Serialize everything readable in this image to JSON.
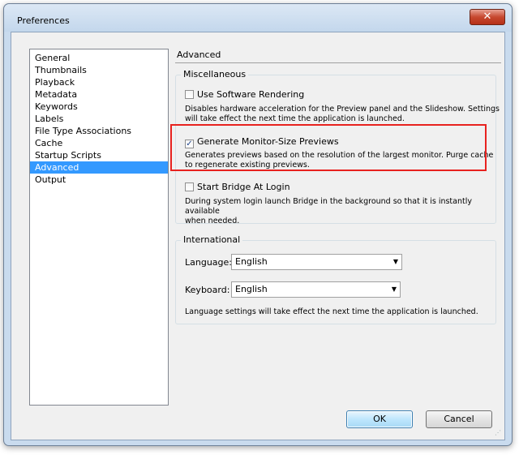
{
  "window": {
    "title": "Preferences",
    "close_glyph": "✕"
  },
  "categories": [
    {
      "label": "General"
    },
    {
      "label": "Thumbnails"
    },
    {
      "label": "Playback"
    },
    {
      "label": "Metadata"
    },
    {
      "label": "Keywords"
    },
    {
      "label": "Labels"
    },
    {
      "label": "File Type Associations"
    },
    {
      "label": "Cache"
    },
    {
      "label": "Startup Scripts"
    },
    {
      "label": "Advanced",
      "selected": true
    },
    {
      "label": "Output"
    }
  ],
  "panel": {
    "title": "Advanced",
    "misc": {
      "label": "Miscellaneous",
      "options": [
        {
          "label": "Use Software Rendering",
          "checked": false,
          "description_lines": [
            "Disables hardware acceleration for the Preview panel and the Slideshow. Settings",
            "will take effect the next time the application is launched."
          ]
        },
        {
          "label": "Generate Monitor-Size Previews",
          "checked": true,
          "description_lines": [
            "Generates previews based on the resolution of the largest monitor.  Purge cache",
            "to regenerate existing previews."
          ]
        },
        {
          "label": "Start Bridge At Login",
          "checked": false,
          "description_lines": [
            "During system login launch Bridge in the background so that it is instantly available",
            "when needed."
          ]
        }
      ]
    },
    "international": {
      "label": "International",
      "language_label": "Language:",
      "language_value": "English",
      "keyboard_label": "Keyboard:",
      "keyboard_value": "English",
      "note": "Language settings will take effect the next time the application is launched."
    },
    "highlight_color": "#e8221f"
  },
  "buttons": {
    "ok": "OK",
    "cancel": "Cancel"
  }
}
